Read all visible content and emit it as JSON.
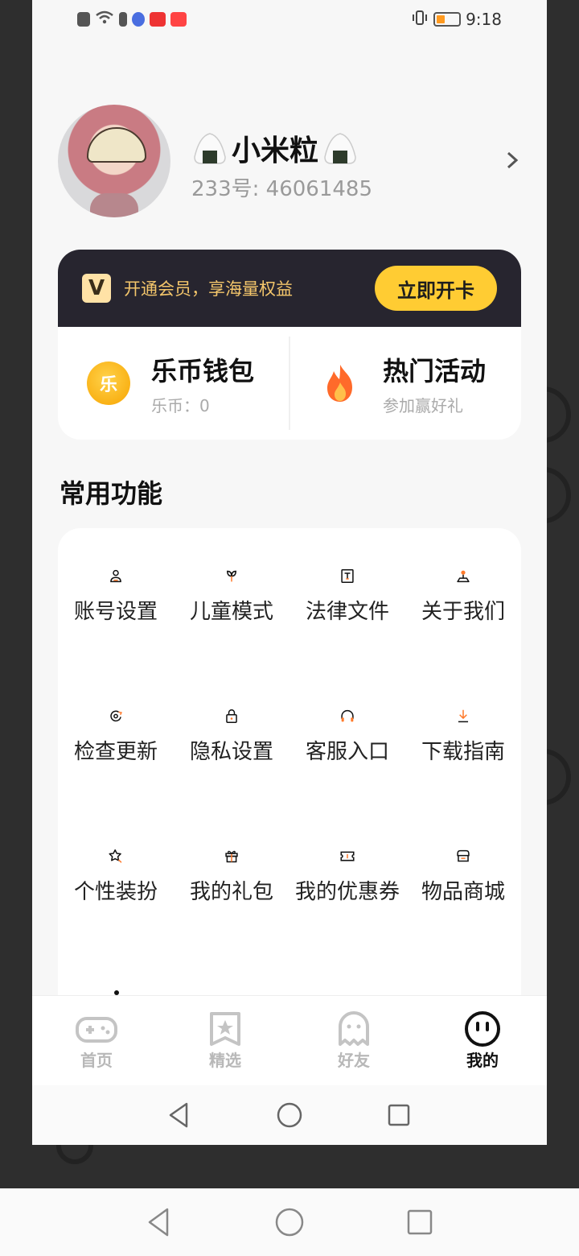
{
  "status_bar": {
    "time": "9:18",
    "left_icons": [
      "alert-icon",
      "wifi-icon",
      "battery-alert-icon",
      "music-app-icon",
      "news-app-icon",
      "sports-app-icon"
    ],
    "right_icons": [
      "vibrate-icon",
      "battery-icon"
    ]
  },
  "profile": {
    "nickname": "小米粒",
    "uid_text": "233号: 46061485"
  },
  "vip": {
    "text": "开通会员，享海量权益",
    "button": "立即开卡",
    "logo_char": "V"
  },
  "wallet": {
    "title": "乐币钱包",
    "subtitle": "乐币：0",
    "coin_char": "乐"
  },
  "events": {
    "title": "热门活动",
    "subtitle": "参加赢好礼"
  },
  "section_title": "常用功能",
  "functions": [
    {
      "label": "账号设置",
      "icon": "user-icon"
    },
    {
      "label": "儿童模式",
      "icon": "sprout-icon"
    },
    {
      "label": "法律文件",
      "icon": "document-icon"
    },
    {
      "label": "关于我们",
      "icon": "location-pin-icon"
    },
    {
      "label": "检查更新",
      "icon": "refresh-icon"
    },
    {
      "label": "隐私设置",
      "icon": "lock-icon"
    },
    {
      "label": "客服入口",
      "icon": "headset-icon"
    },
    {
      "label": "下载指南",
      "icon": "download-icon"
    },
    {
      "label": "个性装扮",
      "icon": "magic-star-icon"
    },
    {
      "label": "我的礼包",
      "icon": "gift-icon"
    },
    {
      "label": "我的优惠券",
      "icon": "ticket-icon"
    },
    {
      "label": "物品商城",
      "icon": "store-icon"
    }
  ],
  "tabs": [
    {
      "label": "首页",
      "icon": "gamepad-icon",
      "active": false
    },
    {
      "label": "精选",
      "icon": "star-badge-icon",
      "active": false
    },
    {
      "label": "好友",
      "icon": "ghost-icon",
      "active": false
    },
    {
      "label": "我的",
      "icon": "smile-face-icon",
      "active": true
    }
  ],
  "colors": {
    "accent": "#ff7a2b",
    "vip_bg": "#27252f",
    "vip_gold": "#f4c66b",
    "vip_button": "#ffcc33"
  }
}
